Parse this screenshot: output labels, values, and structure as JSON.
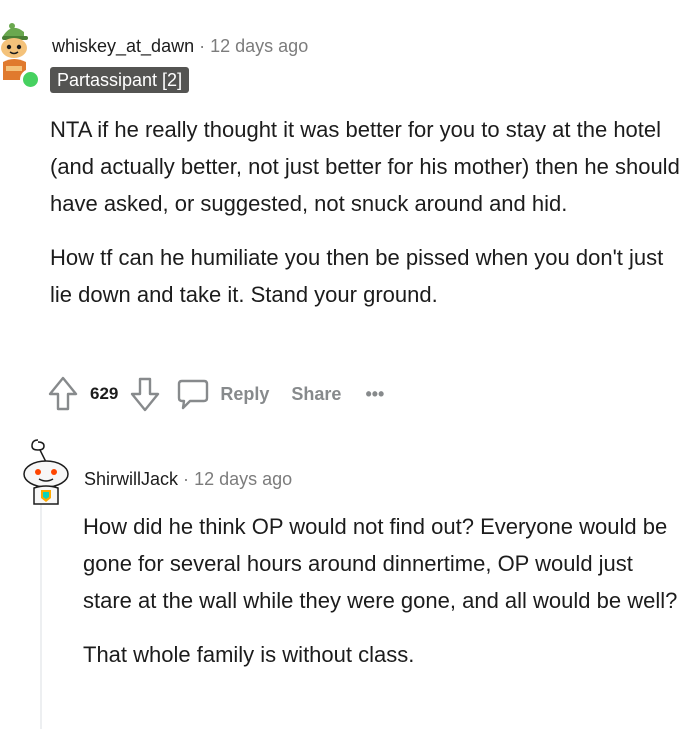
{
  "comment1": {
    "username": "whiskey_at_dawn",
    "separator": "·",
    "timestamp": "12 days ago",
    "flair": "Partassipant [2]",
    "paragraphs": [
      "NTA if he really thought it was better for you to stay at the hotel (and actually better, not just better for his mother) then he should have asked, or suggested, not snuck around and hid.",
      "How tf can he humiliate you then be pissed when you don't just lie down and take it. Stand your ground."
    ],
    "actions": {
      "upvote_icon": "upvote-arrow-icon",
      "score": "629",
      "downvote_icon": "downvote-arrow-icon",
      "reply_icon": "speech-bubble-icon",
      "reply_label": "Reply",
      "share_label": "Share",
      "more_label": "•••"
    },
    "online_color": "#46d160"
  },
  "comment2": {
    "username": "ShirwillJack",
    "separator": "·",
    "timestamp": "12 days ago",
    "paragraphs": [
      "How did he think OP would not find out? Everyone would be gone for several hours around dinnertime, OP would just stare at the wall while they were gone, and all would be well?",
      "That whole family is without class."
    ]
  },
  "colors": {
    "text": "#1c1c1c",
    "muted": "#7c7c7c",
    "action": "#878a8c",
    "flair_bg": "#545452",
    "thread_line": "#edeff1"
  }
}
